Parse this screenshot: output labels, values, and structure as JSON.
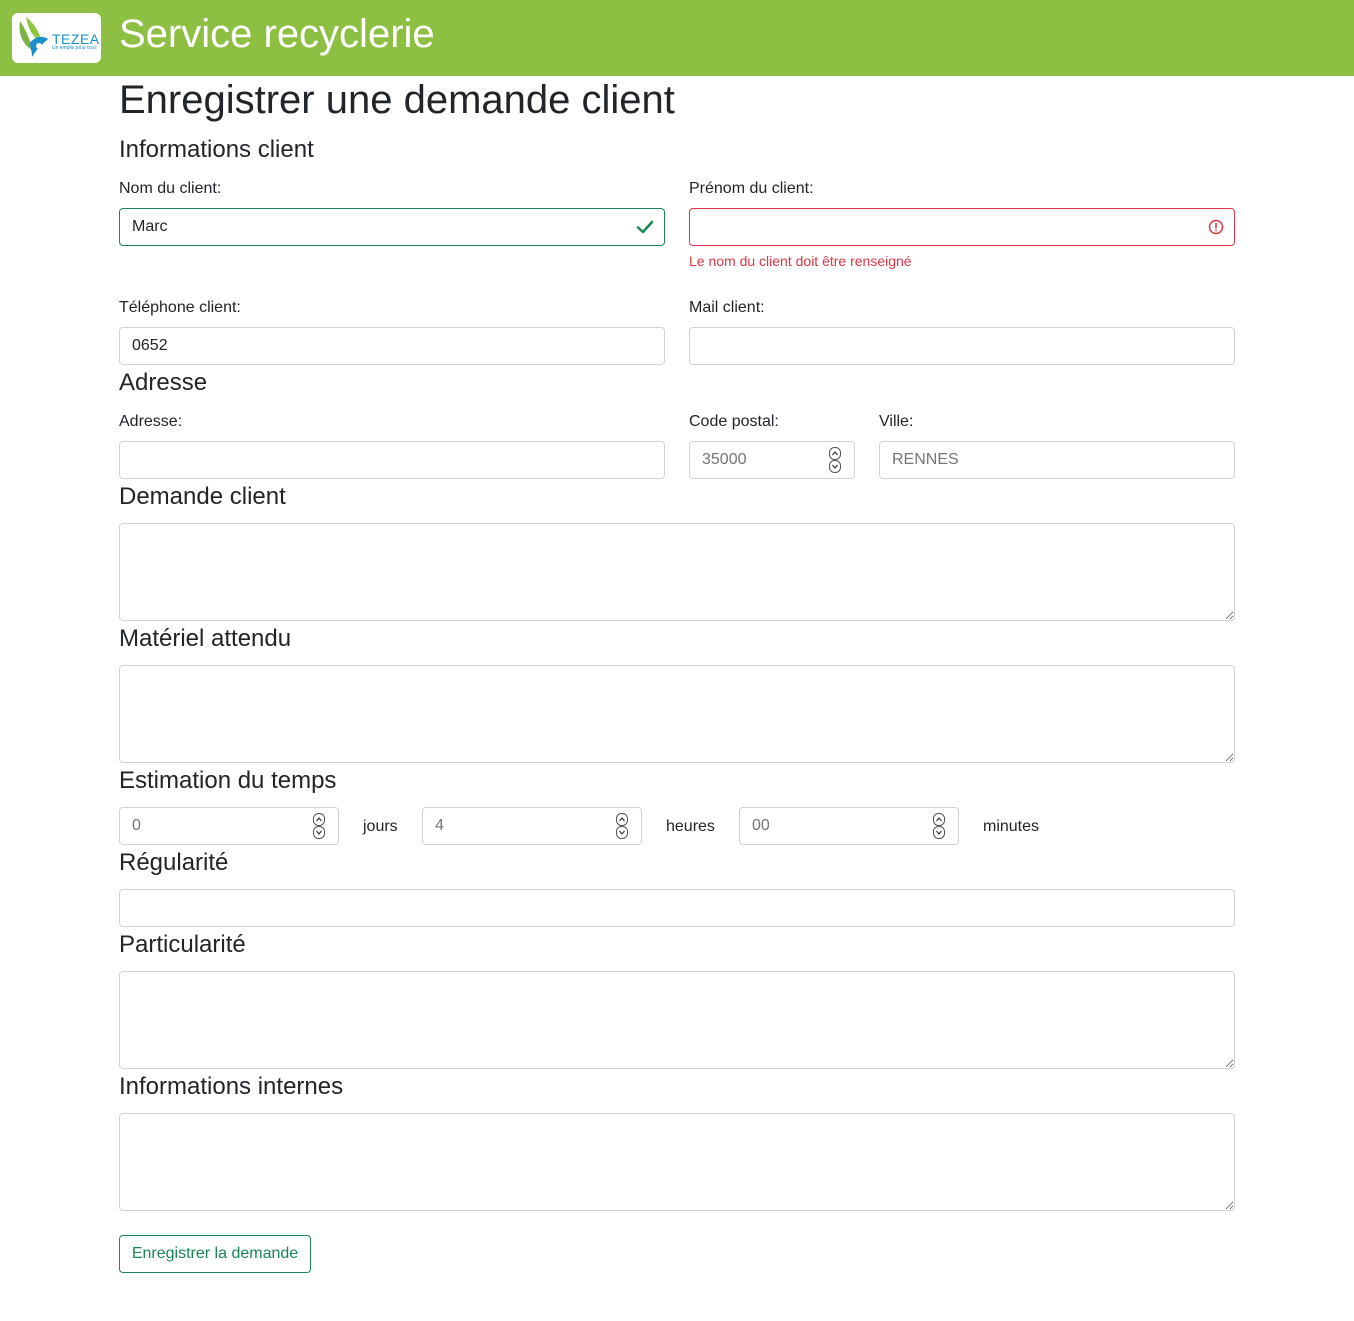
{
  "header": {
    "logo_text": "TEZEA",
    "logo_tagline": "Un emploi pour tous",
    "app_title": "Service recyclerie"
  },
  "page_title": "Enregistrer une demande client",
  "sections": {
    "client_info": "Informations client",
    "address": "Adresse",
    "request": "Demande client",
    "material": "Matériel attendu",
    "time_estimate": "Estimation du temps",
    "regularity": "Régularité",
    "particularity": "Particularité",
    "internal_info": "Informations internes"
  },
  "fields": {
    "last_name": {
      "label": "Nom du client:",
      "value": "Marc",
      "state": "valid"
    },
    "first_name": {
      "label": "Prénom du client:",
      "value": "",
      "state": "invalid",
      "error": "Le nom du client doit être renseigné"
    },
    "phone": {
      "label": "Téléphone client:",
      "value": "0652"
    },
    "email": {
      "label": "Mail client:",
      "value": ""
    },
    "address": {
      "label": "Adresse:",
      "value": ""
    },
    "postal_code": {
      "label": "Code postal:",
      "placeholder": "35000"
    },
    "city": {
      "label": "Ville:",
      "placeholder": "RENNES"
    },
    "request": {
      "value": ""
    },
    "material": {
      "value": ""
    },
    "days": {
      "placeholder": "0",
      "unit": "jours"
    },
    "hours": {
      "placeholder": "4",
      "unit": "heures"
    },
    "minutes": {
      "placeholder": "00",
      "unit": "minutes"
    },
    "regularity": {
      "value": ""
    },
    "particularity": {
      "value": ""
    },
    "internal_info": {
      "value": ""
    }
  },
  "submit_label": "Enregistrer la demande",
  "colors": {
    "header_bg": "#8dbf42",
    "valid": "#198754",
    "invalid": "#dc3545",
    "border": "#ced4da"
  }
}
